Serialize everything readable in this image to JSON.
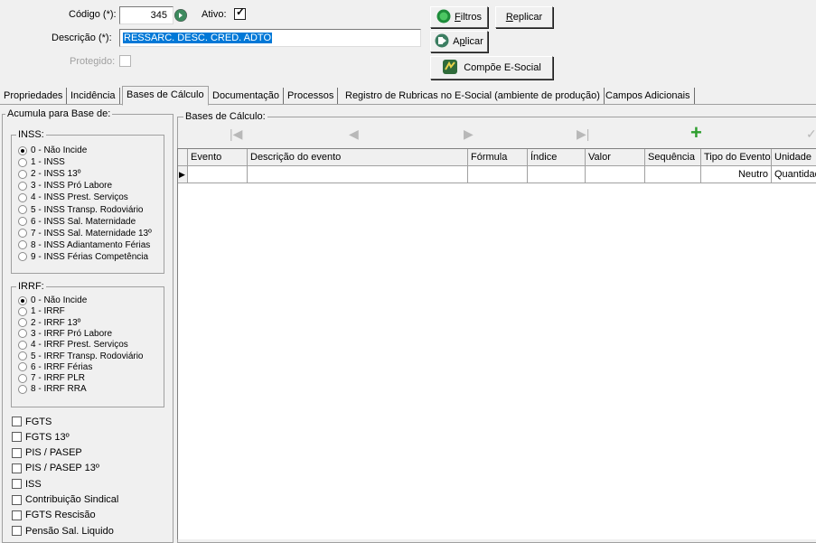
{
  "header": {
    "codigo_label": "Código (*):",
    "codigo_value": "345",
    "ativo_label": "Ativo:",
    "ativo_checked": true,
    "descricao_label": "Descrição (*):",
    "descricao_value": "RESSARC. DESC. CRED. ADTO",
    "protegido_label": "Protegido:",
    "buttons": {
      "filtros": "Filtros",
      "filtros_key": "F",
      "filtros_rest": "iltros",
      "replicar_key": "R",
      "replicar_rest": "eplicar",
      "aplicar_pre": "A",
      "aplicar_key": "p",
      "aplicar_rest": "licar",
      "compoe": "Compõe E-Social"
    }
  },
  "tabs": [
    "Propriedades",
    "Incidência",
    "Bases de Cálculo",
    "Documentação",
    "Processos",
    "Registro de Rubricas no E-Social (ambiente de produção)",
    "Campos Adicionais"
  ],
  "left": {
    "group_title": "Acumula para Base de:",
    "inss": {
      "title": "INSS:",
      "options": [
        "0 - Não Incide",
        "1 - INSS",
        "2 - INSS 13º",
        "3 - INSS Pró Labore",
        "4 - INSS Prest. Serviços",
        "5 - INSS Transp. Rodoviário",
        "6 - INSS Sal. Maternidade",
        "7 - INSS Sal. Maternidade 13º",
        "8 - INSS Adiantamento Férias",
        "9 - INSS Férias Competência"
      ],
      "selected_index": 0
    },
    "irrf": {
      "title": "IRRF:",
      "options": [
        "0 - Não Incide",
        "1 - IRRF",
        "2 - IRRF 13º",
        "3 - IRRF Pró Labore",
        "4 - IRRF Prest. Serviços",
        "5 - IRRF Transp. Rodoviário",
        "6 - IRRF Férias",
        "7 - IRRF PLR",
        "8 - IRRF RRA"
      ],
      "selected_index": 0
    },
    "checks": [
      "FGTS",
      "FGTS 13º",
      "PIS / PASEP",
      "PIS / PASEP 13º",
      "ISS",
      "Contribuição Sindical",
      "FGTS Rescisão",
      "Pensão Sal. Liquido"
    ]
  },
  "bases": {
    "title": "Bases de Cálculo:",
    "nav_icons": [
      "first-icon",
      "prior-icon",
      "next-icon",
      "last-icon",
      "add-icon",
      "confirm-icon"
    ],
    "columns": [
      "Evento",
      "Descrição do evento",
      "Fórmula",
      "Índice",
      "Valor",
      "Sequência",
      "Tipo do Evento",
      "Unidade"
    ],
    "rows": [
      [
        "",
        "",
        "",
        "",
        "",
        "",
        "Neutro",
        "Quantidade"
      ]
    ]
  },
  "colors": {
    "selection": "#0078d7",
    "green": "#2e9e2e",
    "window": "#f0f0f0"
  }
}
